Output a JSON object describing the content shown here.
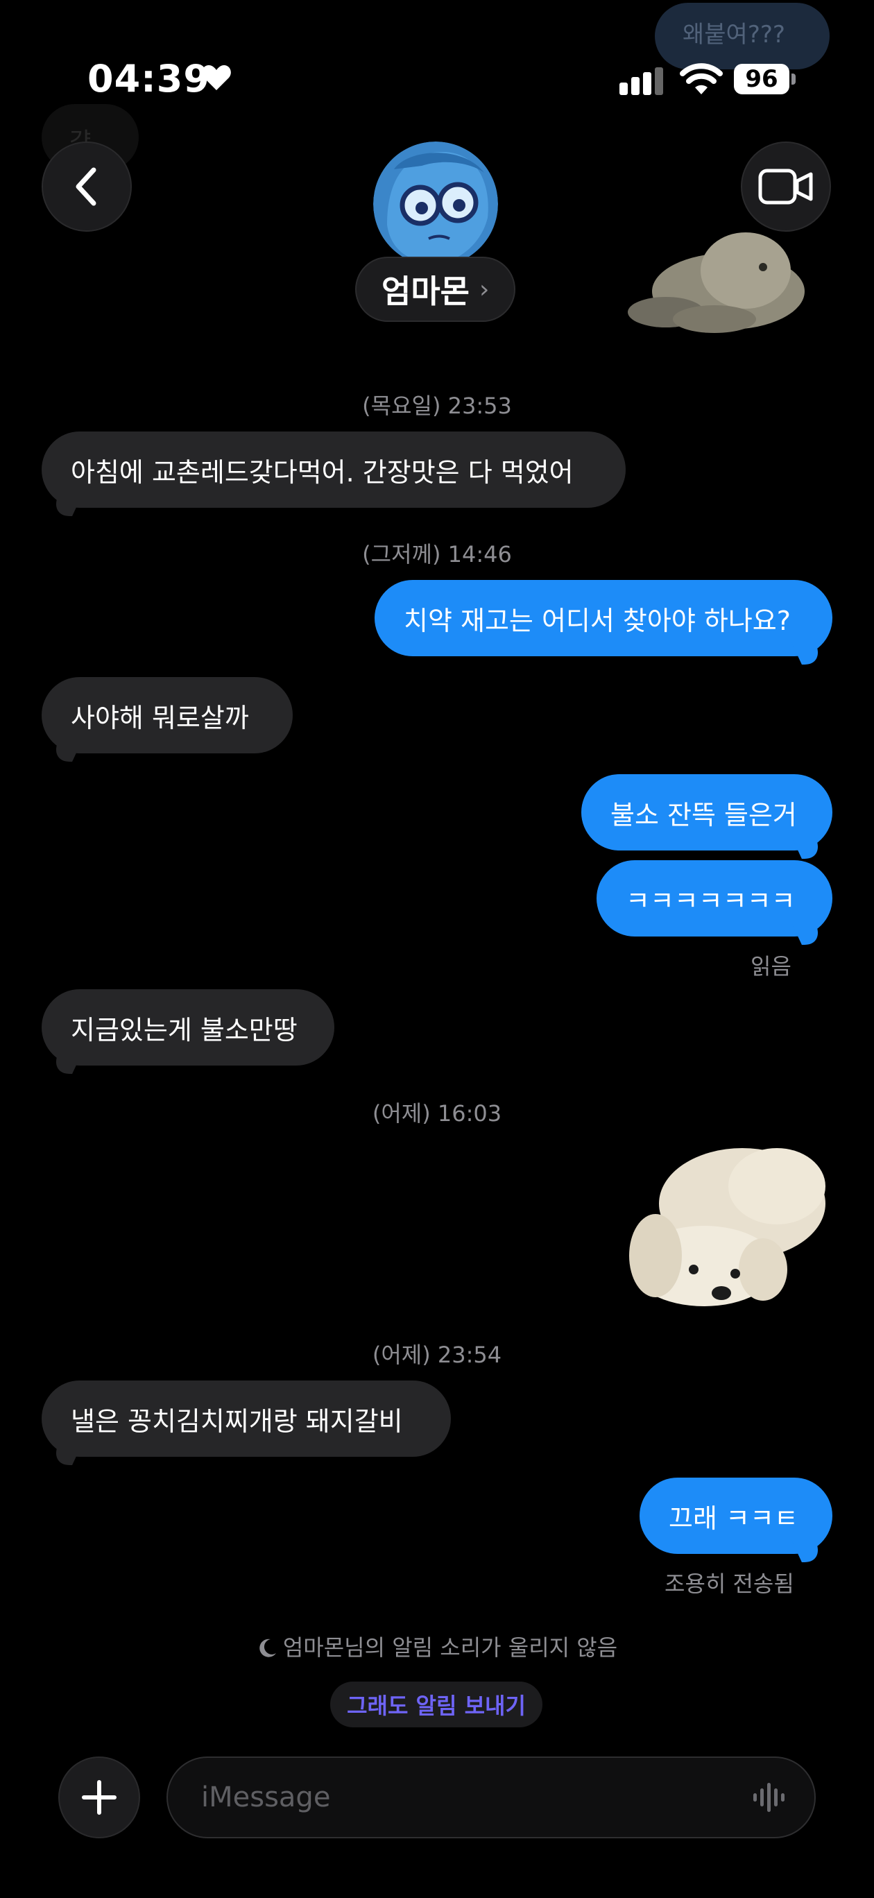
{
  "status_bar": {
    "time": "04:39",
    "battery": "96"
  },
  "ghost": {
    "top_right": "왜붙여???",
    "top_left": "걍"
  },
  "header": {
    "contact_name": "엄마몬",
    "chevron": "›"
  },
  "messages": [
    {
      "timestamp": "(목요일) 23:53"
    },
    {
      "text": "아침에 교촌레드갖다먹어. 간장맛은  다 먹었어"
    },
    {
      "timestamp": "(그저께) 14:46"
    },
    {
      "text": "치약 재고는 어디서 찾아야 하나요?"
    },
    {
      "text": "사야해  뭐로살까"
    },
    {
      "text": "불소 잔뜩 들은거"
    },
    {
      "text": "ㅋㅋㅋㅋㅋㅋㅋ",
      "receipt": "읽음"
    },
    {
      "text": "지금있는게 불소만땅"
    },
    {
      "timestamp": "(어제) 16:03"
    },
    {
      "timestamp": "(어제) 23:54"
    },
    {
      "text": "낼은 꽁치김치찌개랑  돼지갈비"
    },
    {
      "text": "끄래 ㅋㅋㅌ",
      "receipt": "조용히 전송됨"
    }
  ],
  "focus_notice": {
    "text": "엄마몬님의 알림 소리가 울리지 않음",
    "button": "그래도 알림 보내기"
  },
  "composer": {
    "placeholder": "iMessage"
  },
  "colors": {
    "outgoing": "#1d8cf8",
    "incoming": "#262628",
    "notify_accent": "#6e64f6"
  }
}
